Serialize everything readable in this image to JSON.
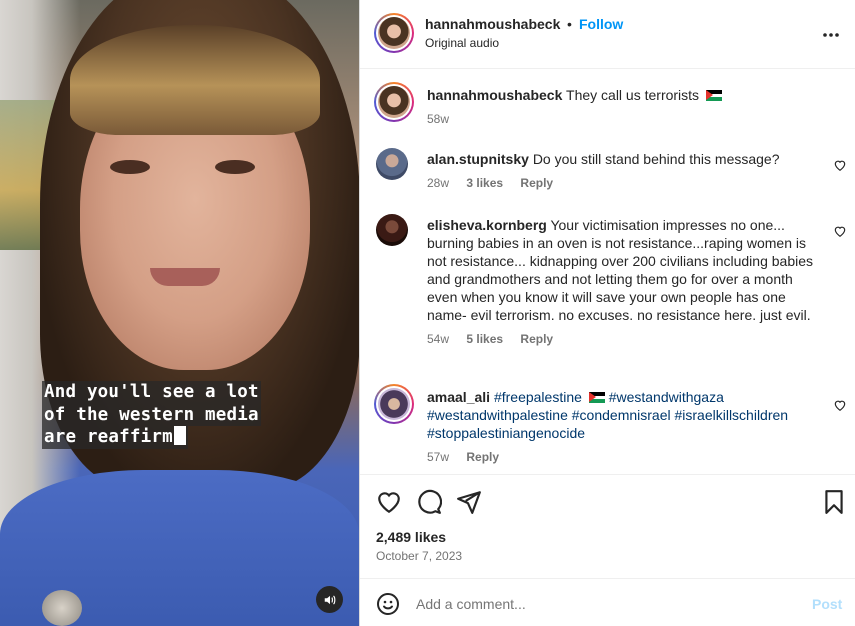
{
  "video": {
    "caption_lines": [
      "And you'll see a lot",
      "of the western media",
      "are reaffirm"
    ],
    "mute_icon": "speaker-icon"
  },
  "header": {
    "username": "hannahmoushabeck",
    "separator": "•",
    "follow_label": "Follow",
    "audio": "Original audio",
    "more_icon": "more-icon"
  },
  "caption_post": {
    "username": "hannahmoushabeck",
    "text": "They call us terrorists",
    "flag_icon": "palestine-flag-icon",
    "time": "58w"
  },
  "comments": [
    {
      "username": "alan.stupnitsky",
      "text": "Do you still stand behind this message?",
      "time": "28w",
      "likes": "3 likes",
      "reply": "Reply"
    },
    {
      "username": "elisheva.kornberg",
      "text": "Your victimisation impresses no one... burning babies in an oven is not resistance...raping women is not resistance... kidnapping over 200 civilians including babies and grandmothers and not letting them go for over a month even when you know it will save your own people has one name- evil terrorism. no excuses. no resistance here. just evil.",
      "time": "54w",
      "likes": "5 likes",
      "reply": "Reply"
    },
    {
      "username": "amaal_ali",
      "tag1": "#freepalestine",
      "tags_rest": "#westandwithgaza #westandwithpalestine #condemnisrael #israelkillschildren #stoppalestiniangenocide",
      "time": "57w",
      "reply": "Reply"
    }
  ],
  "actions": {
    "likes": "2,489 likes",
    "date": "October 7, 2023"
  },
  "add_comment": {
    "placeholder": "Add a comment...",
    "post_label": "Post"
  },
  "colors": {
    "link_blue": "#0095f6",
    "hashtag": "#00376b",
    "muted": "#737373",
    "post_disabled": "#b2dffc"
  }
}
